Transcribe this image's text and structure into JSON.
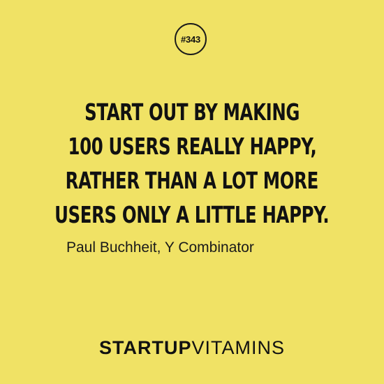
{
  "colors": {
    "background": "#F0E265",
    "text": "#111111"
  },
  "badge": {
    "label": "#343"
  },
  "quote": {
    "lines": [
      "START OUT BY MAKING",
      "100 USERS REALLY HAPPY,",
      "RATHER THAN A LOT MORE",
      "USERS ONLY A LITTLE HAPPY."
    ]
  },
  "author": {
    "label": "Paul Buchheit, Y Combinator"
  },
  "brand": {
    "part1": "STARTUP",
    "part2": "VITAMINS"
  }
}
